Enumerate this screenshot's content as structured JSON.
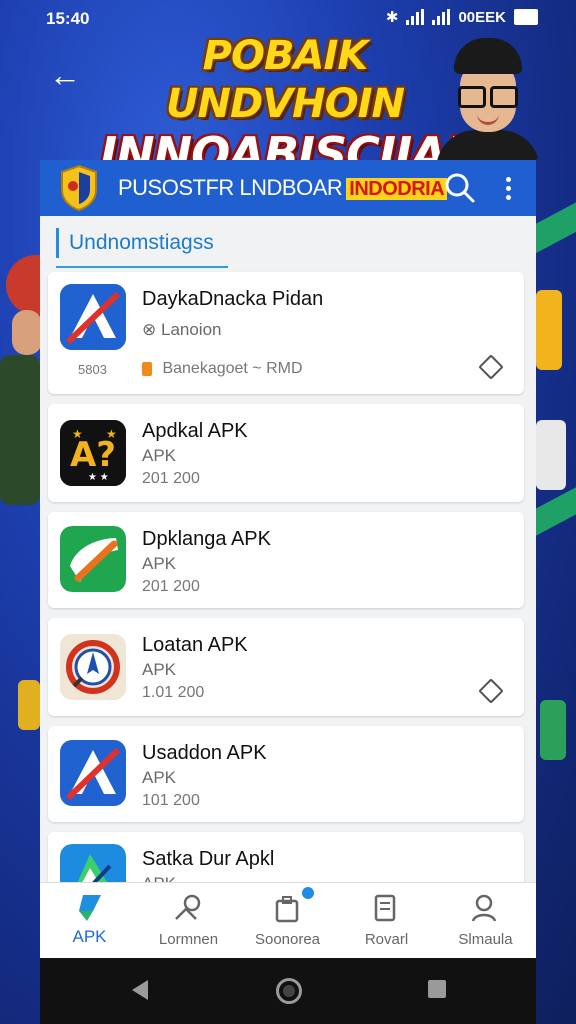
{
  "status_bar": {
    "time": "15:40",
    "battery_text": "00EEK"
  },
  "banner": {
    "line1": "POBAIK UNDVHOIN",
    "line2": "INNOABISCIIAR"
  },
  "app_bar": {
    "title": "PUSOSTFR LNDBOAR",
    "highlight": "INDODRIA"
  },
  "section": {
    "title": "Undnomstiagss"
  },
  "apps": [
    {
      "name": "DaykaDnacka Pidan",
      "sub": "Lanoion",
      "meta_left": "5803",
      "meta_right": "Banekagoet ~ RMD",
      "icon": "blue-arrow-icon"
    },
    {
      "name": "Apdkal APK",
      "sub": "APK",
      "meta": "201 200",
      "icon": "a-star-icon"
    },
    {
      "name": "Dpklanga APK",
      "sub": "APK",
      "meta": "201 200",
      "icon": "green-arrow-icon"
    },
    {
      "name": "Loatan APK",
      "sub": "APK",
      "meta": "1.01 200",
      "icon": "compass-icon"
    },
    {
      "name": "Usaddon APK",
      "sub": "APK",
      "meta": "101 200",
      "icon": "blue-arrow-icon"
    },
    {
      "name": "Satka Dur Apkl",
      "sub": "APK",
      "meta": "",
      "icon": "teal-arrow-icon"
    }
  ],
  "bottom_nav": [
    {
      "label": "APK",
      "icon": "apk-icon",
      "active": true
    },
    {
      "label": "Lormnen",
      "icon": "link-icon",
      "active": false
    },
    {
      "label": "Soonorea",
      "icon": "bag-icon",
      "active": false
    },
    {
      "label": "Rovarl",
      "icon": "document-icon",
      "active": false
    },
    {
      "label": "Slmaula",
      "icon": "profile-icon",
      "active": false
    }
  ],
  "colors": {
    "accent": "#1f5fcf",
    "highlight": "#ffd21a",
    "active_nav": "#1f6ad6"
  }
}
